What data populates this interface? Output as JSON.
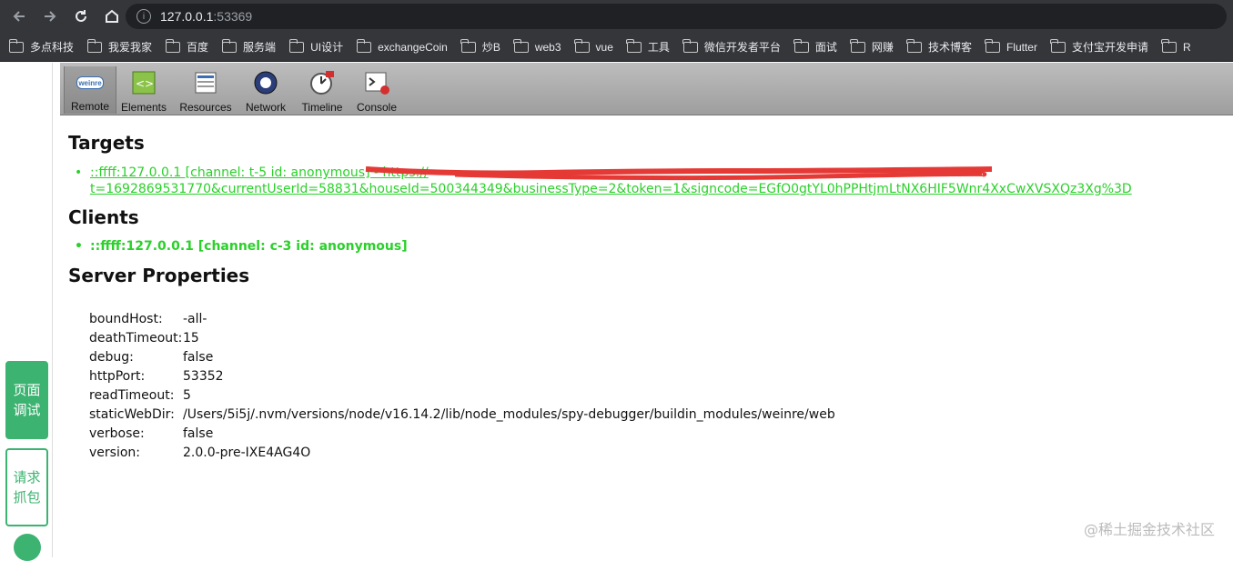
{
  "browser": {
    "url_host": "127.0.0.1",
    "url_port": ":53369",
    "bookmarks": [
      "多点科技",
      "我爱我家",
      "百度",
      "服务端",
      "UI设计",
      "exchangeCoin",
      "炒B",
      "web3",
      "vue",
      "工具",
      "微信开发者平台",
      "面试",
      "网赚",
      "技术博客",
      "Flutter",
      "支付宝开发申请",
      "R"
    ]
  },
  "side": {
    "debug_label": "页面调试",
    "capture_label": "请求抓包"
  },
  "toolbar": {
    "tools": [
      "Remote",
      "Elements",
      "Resources",
      "Network",
      "Timeline",
      "Console"
    ],
    "remote_logo": "weinre"
  },
  "targets": {
    "heading": "Targets",
    "link_line1": "::ffff:127.0.0.1 [channel: t-5 id: anonymous] - https://",
    "link_line2": "t=1692869531770&currentUserId=58831&houseId=500344349&businessType=2&token=1&signcode=EGfO0gtYL0hPPHtjmLtNX6HIF5Wnr4XxCwXVSXQz3Xg%3D"
  },
  "clients": {
    "heading": "Clients",
    "item": "::ffff:127.0.0.1 [channel: c-3 id: anonymous]"
  },
  "server": {
    "heading": "Server Properties",
    "props": [
      {
        "key": "boundHost:",
        "value": "-all-"
      },
      {
        "key": "deathTimeout:",
        "value": "15"
      },
      {
        "key": "debug:",
        "value": "false"
      },
      {
        "key": "httpPort:",
        "value": "53352"
      },
      {
        "key": "readTimeout:",
        "value": "5"
      },
      {
        "key": "staticWebDir:",
        "value": "/Users/5i5j/.nvm/versions/node/v16.14.2/lib/node_modules/spy-debugger/buildin_modules/weinre/web"
      },
      {
        "key": "verbose:",
        "value": "false"
      },
      {
        "key": "version:",
        "value": "2.0.0-pre-IXE4AG4O"
      }
    ]
  },
  "watermark": "@稀土掘金技术社区",
  "colors": {
    "accent_green": "#2bd02b",
    "side_green": "#3cb371",
    "browser_dark": "#35363a"
  }
}
